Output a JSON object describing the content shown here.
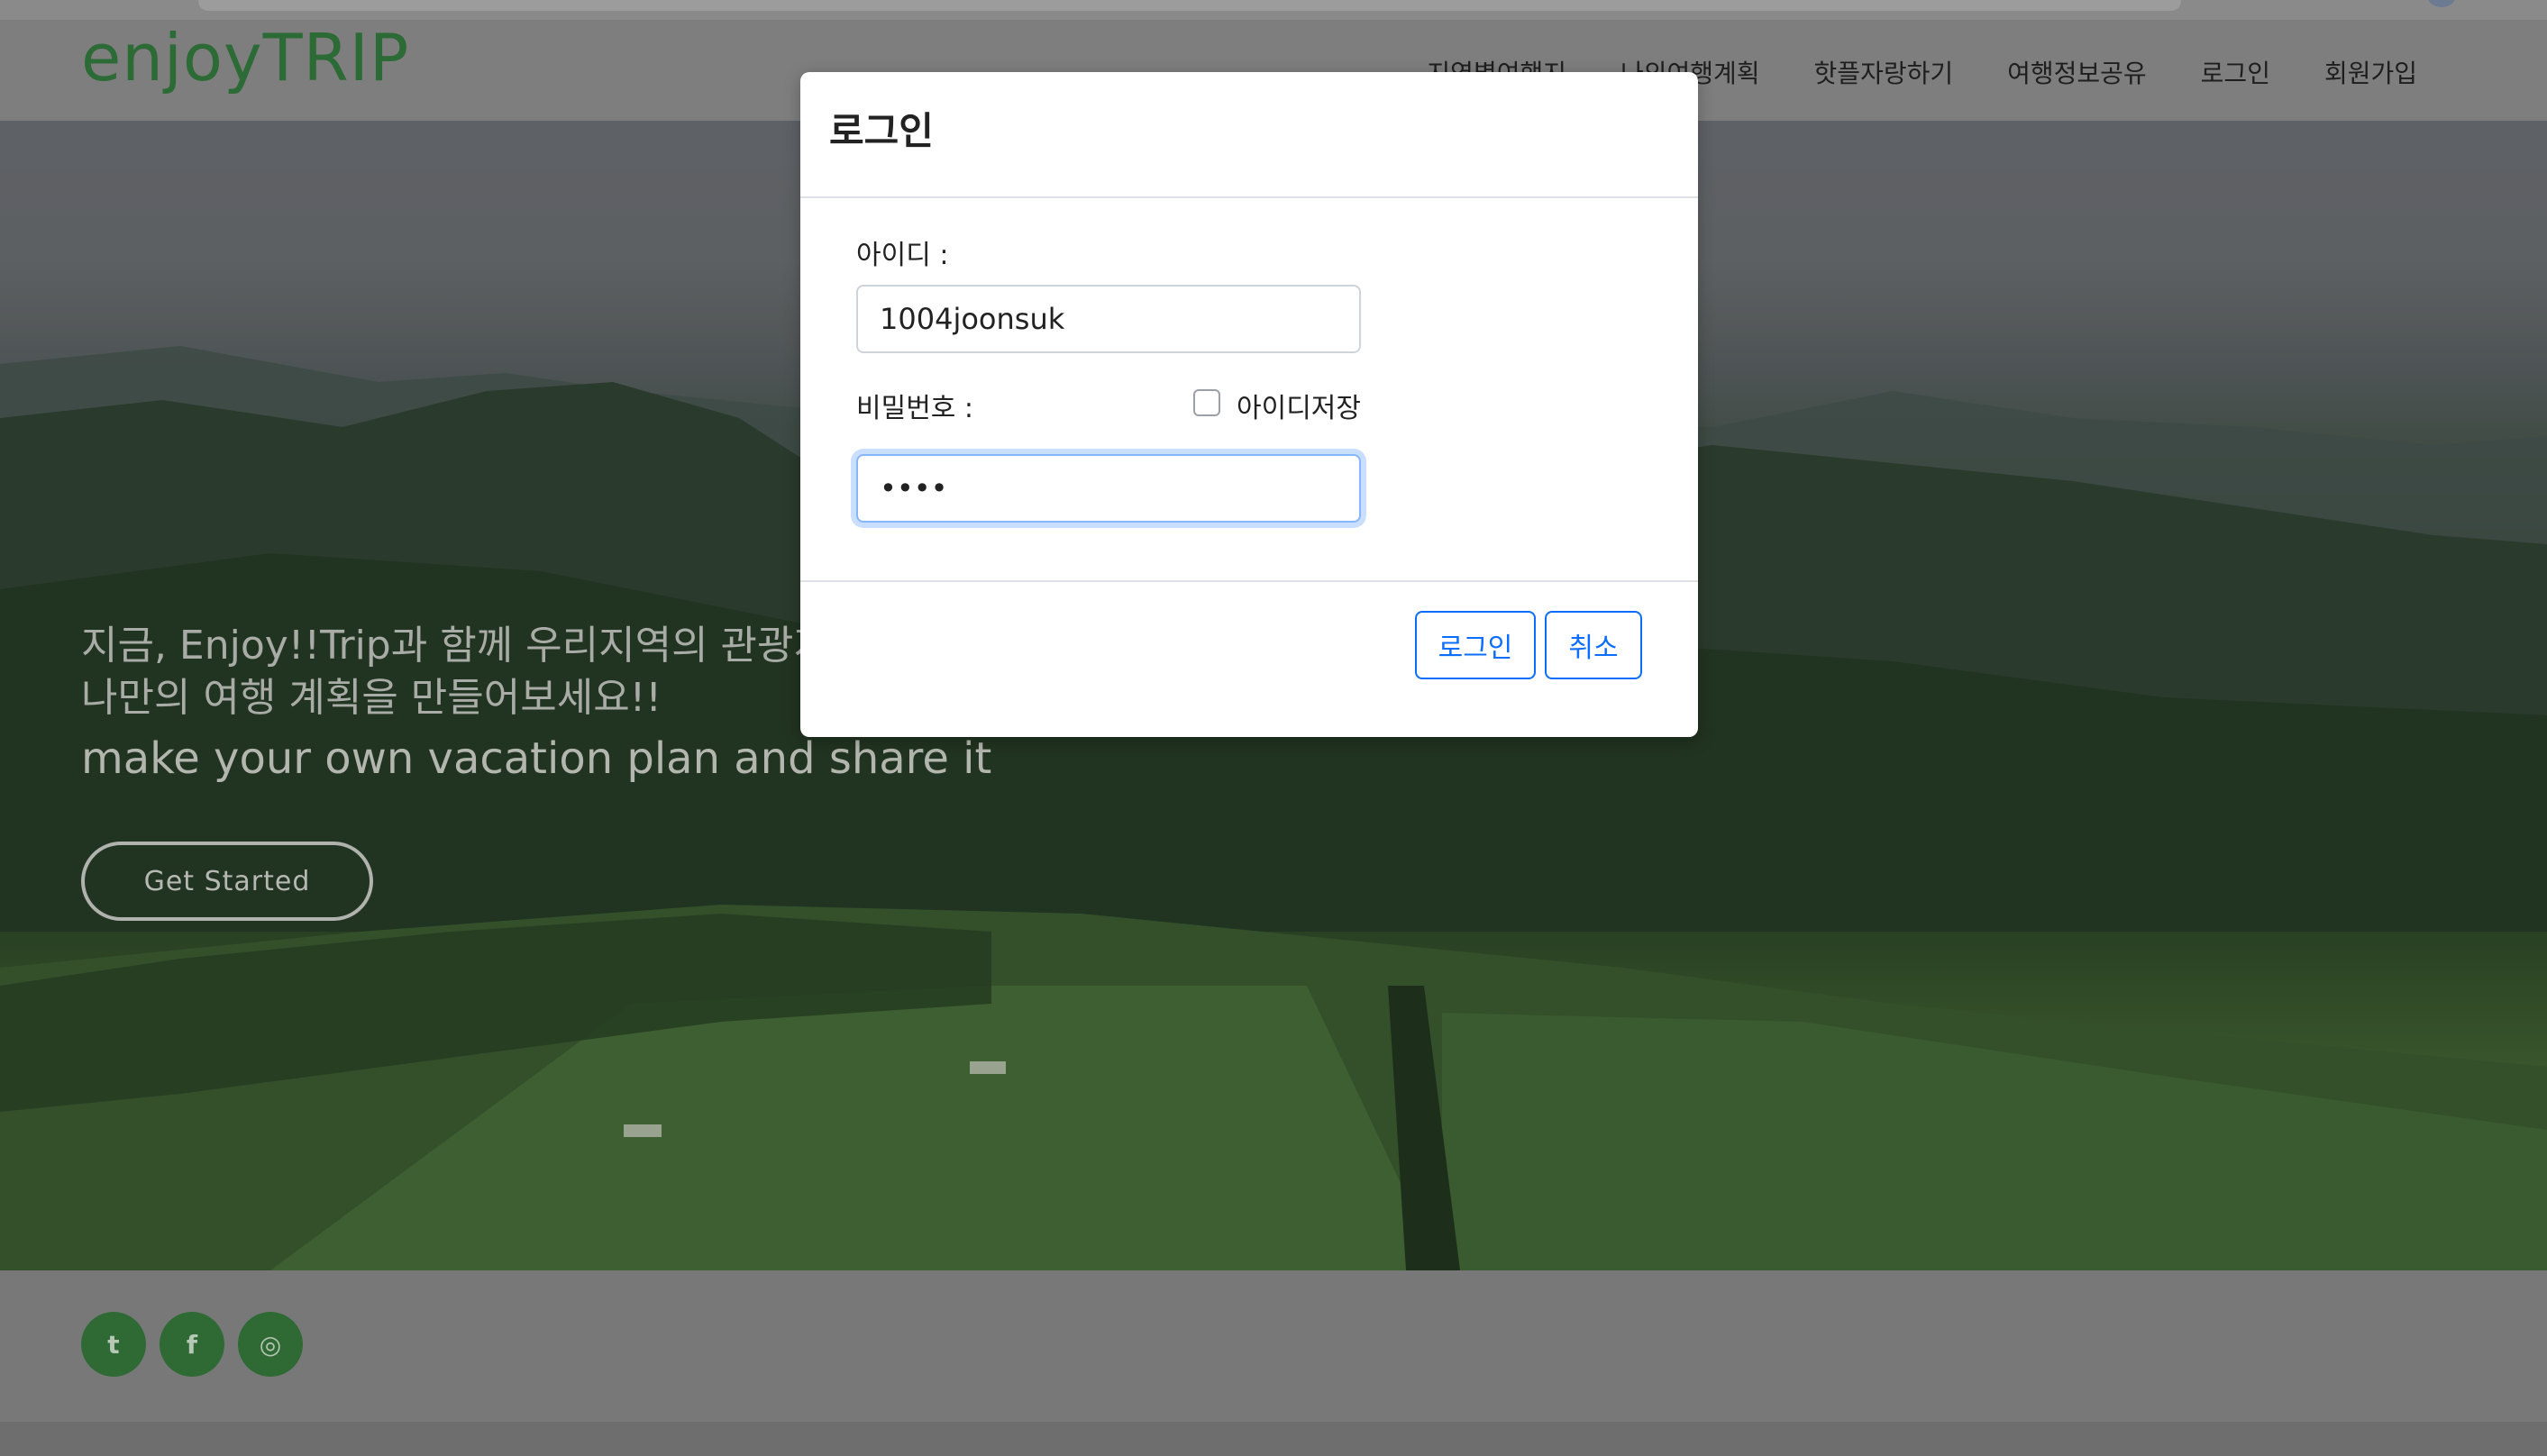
{
  "header": {
    "logo": "enjoyTRIP",
    "nav": [
      "지역별여행지",
      "나의여행계획",
      "핫플자랑하기",
      "여행정보공유",
      "로그인",
      "회원가입"
    ]
  },
  "hero": {
    "line1": "지금, Enjoy!!Trip과 함께 우리지역의 관광지",
    "line2": "나만의 여행 계획을 만들어보세요!!",
    "subtitle": "make your own vacation plan and share it",
    "cta": "Get Started"
  },
  "footer": {
    "social": [
      {
        "name": "twitter-icon",
        "glyph": "t"
      },
      {
        "name": "facebook-icon",
        "glyph": "f"
      },
      {
        "name": "instagram-icon",
        "glyph": "◎"
      }
    ]
  },
  "modal": {
    "title": "로그인",
    "id_label": "아이디 :",
    "id_value": "1004joonsuk",
    "password_label": "비밀번호 :",
    "password_value": "••••",
    "remember_label": "아이디저장",
    "login_button": "로그인",
    "cancel_button": "취소"
  },
  "colors": {
    "brand": "#2c6a36",
    "primary": "#0d6efd"
  }
}
